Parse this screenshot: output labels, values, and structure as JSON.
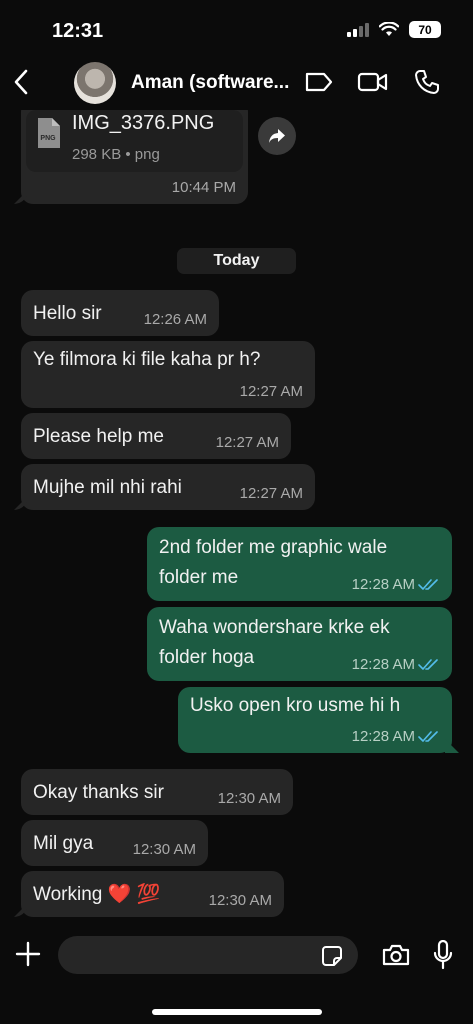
{
  "status_bar": {
    "time": "12:31",
    "battery": "70"
  },
  "header": {
    "contact_name": "Aman (software..."
  },
  "file_message": {
    "file_name": "IMG_3376.PNG",
    "file_meta": "298 KB • png",
    "file_type": "PNG",
    "time": "10:44 PM"
  },
  "date_separator": "Today",
  "messages": [
    {
      "direction": "in",
      "lines": [
        "Hello sir"
      ],
      "time": "12:26 AM"
    },
    {
      "direction": "in",
      "lines": [
        "Ye filmora ki file kaha pr h?"
      ],
      "time": "12:27 AM"
    },
    {
      "direction": "in",
      "lines": [
        "Please help me"
      ],
      "time": "12:27 AM"
    },
    {
      "direction": "in",
      "lines": [
        "Mujhe mil nhi rahi"
      ],
      "time": "12:27 AM"
    },
    {
      "direction": "out",
      "lines": [
        "2nd folder me graphic wale",
        "folder me"
      ],
      "time": "12:28 AM",
      "status": "read"
    },
    {
      "direction": "out",
      "lines": [
        "Waha wondershare krke ek",
        "folder hoga"
      ],
      "time": "12:28 AM",
      "status": "read"
    },
    {
      "direction": "out",
      "lines": [
        "Usko open kro usme hi h"
      ],
      "time": "12:28 AM",
      "status": "read"
    },
    {
      "direction": "in",
      "lines": [
        "Okay thanks sir"
      ],
      "time": "12:30 AM"
    },
    {
      "direction": "in",
      "lines": [
        "Mil gya"
      ],
      "time": "12:30 AM"
    },
    {
      "direction": "in",
      "lines": [
        "Working ❤️ 💯"
      ],
      "time": "12:30 AM"
    }
  ],
  "composer": {
    "placeholder": ""
  },
  "colors": {
    "incoming_bubble": "#262626",
    "outgoing_bubble": "#1c5b42",
    "read_ticks": "#53bdeb",
    "background": "#0b0b0b"
  },
  "icons": [
    "back-icon",
    "tag-icon",
    "video-call-icon",
    "phone-icon",
    "forward-icon",
    "plus-icon",
    "sticker-icon",
    "camera-icon",
    "microphone-icon",
    "double-check-icon",
    "png-file-icon",
    "wifi-icon",
    "signal-icon",
    "battery-icon"
  ]
}
